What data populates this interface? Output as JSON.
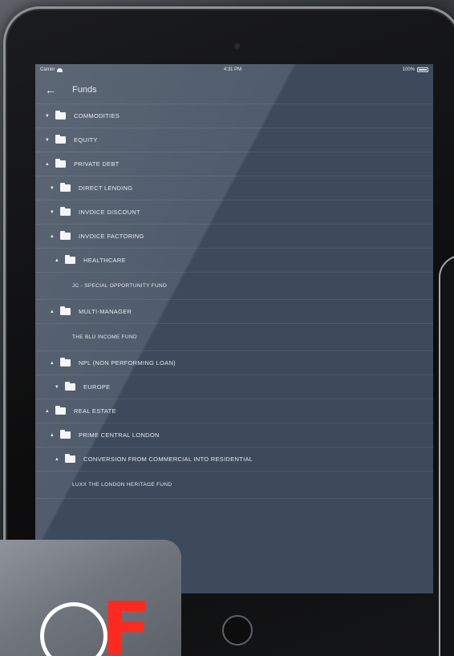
{
  "status_bar": {
    "carrier": "Carrier",
    "time": "4:31 PM",
    "battery": "100%"
  },
  "nav": {
    "back_icon": "back-arrow-icon",
    "title": "Funds"
  },
  "tree": [
    {
      "label": "COMMODITIES",
      "depth": 0,
      "expanded": false,
      "type": "folder"
    },
    {
      "label": "EQUITY",
      "depth": 0,
      "expanded": false,
      "type": "folder"
    },
    {
      "label": "PRIVATE DEBT",
      "depth": 0,
      "expanded": true,
      "type": "folder"
    },
    {
      "label": "DIRECT LENDING",
      "depth": 1,
      "expanded": false,
      "type": "folder"
    },
    {
      "label": "INVOICE DISCOUNT",
      "depth": 1,
      "expanded": false,
      "type": "folder"
    },
    {
      "label": "INVOICE FACTORING",
      "depth": 1,
      "expanded": true,
      "type": "folder"
    },
    {
      "label": "HEALTHCARE",
      "depth": 2,
      "expanded": true,
      "type": "folder"
    },
    {
      "label": "JC - SPECIAL OPPORTUNITY FUND",
      "depth": 0,
      "type": "fund"
    },
    {
      "label": "MULTI-MANAGER",
      "depth": 1,
      "expanded": true,
      "type": "folder"
    },
    {
      "label": "THE BLU INCOME FUND",
      "depth": 0,
      "type": "fund"
    },
    {
      "label": "NPL (NON PERFORMING LOAN)",
      "depth": 1,
      "expanded": true,
      "type": "folder"
    },
    {
      "label": "EUROPE",
      "depth": 2,
      "expanded": false,
      "type": "folder"
    },
    {
      "label": "REAL ESTATE",
      "depth": 0,
      "expanded": true,
      "type": "folder"
    },
    {
      "label": "PRIME CENTRAL LONDON",
      "depth": 1,
      "expanded": true,
      "type": "folder"
    },
    {
      "label": "CONVERSION FROM COMMERCIAL INTO RESIDENTIAL",
      "depth": 2,
      "expanded": true,
      "type": "folder"
    },
    {
      "label": "LUXX THE LONDON HERITAGE FUND",
      "depth": 0,
      "type": "fund"
    }
  ],
  "app_icon": {
    "letter": "F",
    "ring_color": "#ffffff",
    "letter_color": "#ff2a1f"
  },
  "colors": {
    "screen_bg": "#3d4a5b",
    "divider": "#4b596a",
    "text": "#e3e8ee"
  }
}
